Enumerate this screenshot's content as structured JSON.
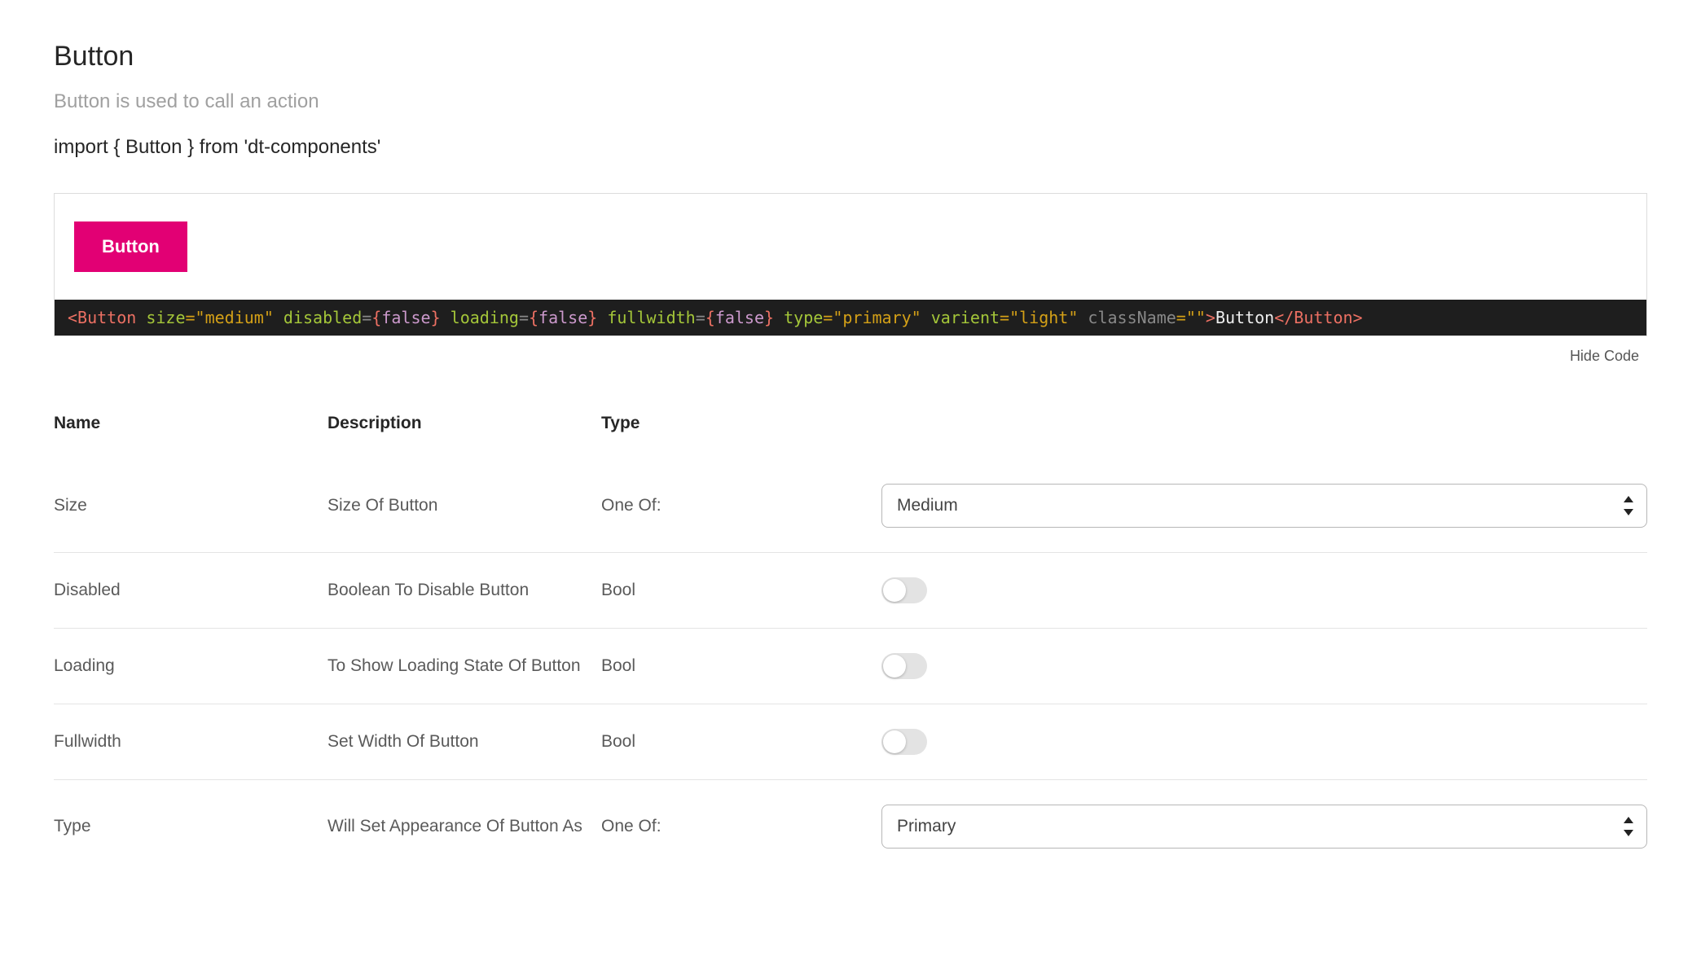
{
  "page": {
    "title": "Button",
    "subtitle": "Button is used to call an action",
    "import_line": "import { Button } from 'dt-components'"
  },
  "demo": {
    "button_label": "Button"
  },
  "code_snippet": {
    "p1": "<Button ",
    "a_size": "size",
    "s_size": "=\"medium\"",
    "a_disabled": " disabled",
    "eq1": "=",
    "br_o1": "{",
    "false1": "false",
    "br_c1": "}",
    "a_loading": " loading",
    "eq2": "=",
    "br_o2": "{",
    "false2": "false",
    "br_c2": "}",
    "a_fullwidth": " fullwidth",
    "eq3": "=",
    "br_o3": "{",
    "false3": "false",
    "br_c3": "}",
    "a_type": " type",
    "s_type": "=\"primary\"",
    "a_varient": " varient",
    "s_varient": "=\"light\"",
    "a_class": " className",
    "s_class": "=\"\"",
    "close_open_tag": ">",
    "inner_text": "Button",
    "close_tag": "</Button>"
  },
  "actions": {
    "hide_code": "Hide Code"
  },
  "table": {
    "head": {
      "name": "Name",
      "description": "Description",
      "type": "Type"
    }
  },
  "rows": {
    "size": {
      "name": "Size",
      "desc": "Size Of Button",
      "type": "One Of:",
      "value": "Medium"
    },
    "disabled": {
      "name": "Disabled",
      "desc": "Boolean To Disable Button",
      "type": "Bool"
    },
    "loading": {
      "name": "Loading",
      "desc": "To Show Loading State Of Button",
      "type": "Bool"
    },
    "fullwidth": {
      "name": "Fullwidth",
      "desc": "Set Width Of Button",
      "type": "Bool"
    },
    "typeprop": {
      "name": "Type",
      "desc": "Will Set Appearance Of Button As",
      "type": "One Of:",
      "value": "Primary"
    }
  },
  "colors": {
    "brand": "#e20074"
  }
}
